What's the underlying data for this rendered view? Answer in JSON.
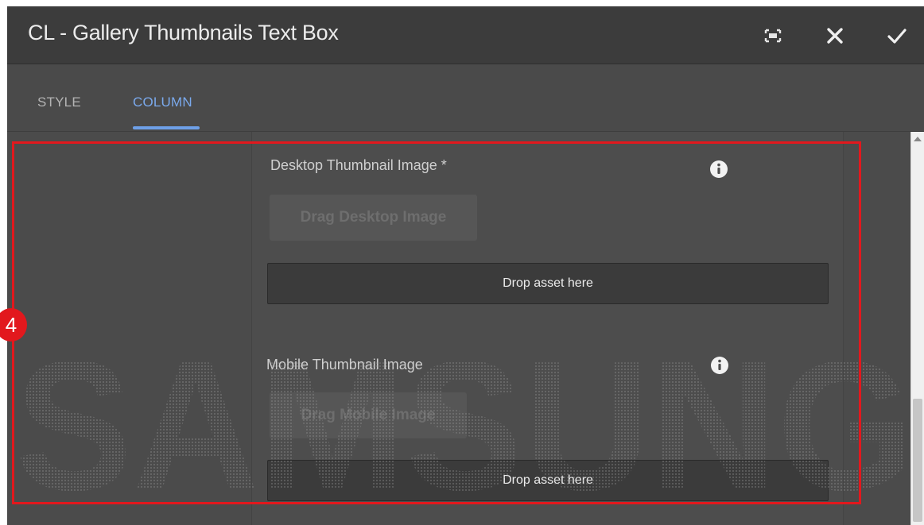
{
  "dialog": {
    "title": "CL - Gallery Thumbnails Text Box",
    "actions": {
      "fullscreen_icon": "fullscreen-icon",
      "close_icon": "close-icon",
      "confirm_icon": "checkmark-icon"
    }
  },
  "tabs": [
    {
      "label": "STYLE",
      "active": false
    },
    {
      "label": "COLUMN",
      "active": true
    }
  ],
  "fields": [
    {
      "label": "Desktop Thumbnail Image *",
      "drag_label": "Drag Desktop Image",
      "drop_label": "Drop asset here",
      "info_icon": "info-icon"
    },
    {
      "label": "Mobile Thumbnail Image",
      "drag_label": "Drag Mobile Image",
      "drop_label": "Drop asset here",
      "info_icon": "info-icon"
    }
  ],
  "annotation": {
    "step_number": "4",
    "color": "#e2181d"
  },
  "watermark": {
    "text": "SAMSUNG"
  },
  "colors": {
    "accent": "#7aa9ec",
    "header_bg": "#3c3c3c",
    "panel_bg": "#4e4e4e"
  }
}
